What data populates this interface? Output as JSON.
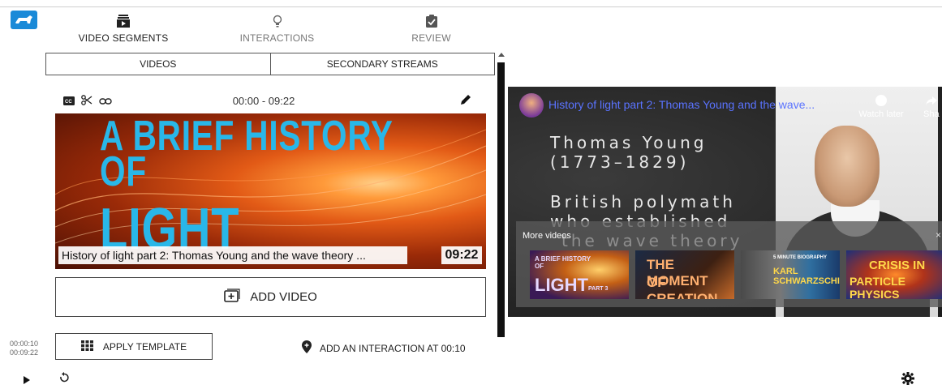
{
  "nav": {
    "tabs": [
      {
        "label": "VIDEO SEGMENTS",
        "icon": "film-stack-icon",
        "active": true
      },
      {
        "label": "INTERACTIONS",
        "icon": "lightbulb-icon",
        "active": false
      },
      {
        "label": "REVIEW",
        "icon": "clipboard-check-icon",
        "active": false
      }
    ]
  },
  "stream_tabs": [
    "VIDEOS",
    "SECONDARY STREAMS"
  ],
  "segment": {
    "time_range": "00:00 - 09:22",
    "icons": [
      "closed-captions-icon",
      "scissors-icon",
      "link-icon",
      "pencil-icon"
    ],
    "thumbnail_text": [
      "A BRIEF HISTORY",
      "OF",
      "LIGHT"
    ],
    "caption": "History of light part 2: Thomas Young and the wave theory ...",
    "duration": "09:22"
  },
  "add_video_label": "ADD VIDEO",
  "apply_template_label": "APPLY TEMPLATE",
  "add_interaction_label": "ADD AN INTERACTION AT 00:10",
  "playback": {
    "current": "00:00:10",
    "total": "00:09:22"
  },
  "player": {
    "title": "History of light part 2: Thomas Young and the wave...",
    "watch_later": "Watch later",
    "share": "Sha",
    "slide_lines": [
      "Thomas Young",
      "(1773–1829)",
      "British polymath",
      "who established"
    ],
    "faded_line": "the wave theory",
    "more_videos_label": "More videos",
    "more_close": "×",
    "more_items": [
      {
        "lines": [
          "A BRIEF HISTORY",
          "OF",
          "LIGHT",
          "PART 3"
        ]
      },
      {
        "lines": [
          "THE MOMENT",
          "OF CREATION"
        ]
      },
      {
        "lines": [
          "5 MINUTE BIOGRAPHY",
          "KARL",
          "SCHWARZSCHILD"
        ]
      },
      {
        "lines": [
          "CRISIS IN",
          "PARTICLE PHYSICS"
        ]
      }
    ]
  },
  "colors": {
    "logo": "#1a8ad8",
    "title_link": "#5a73ff",
    "thumb_text": "#29b7e8"
  }
}
